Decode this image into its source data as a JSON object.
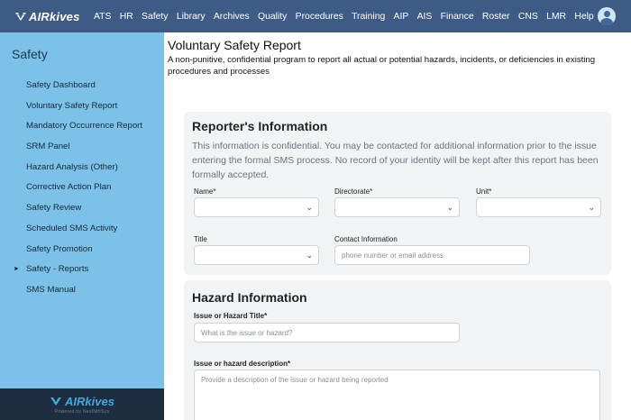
{
  "brand": {
    "name": "AIRkives"
  },
  "nav": {
    "items": [
      "ATS",
      "HR",
      "Safety",
      "Library",
      "Archives",
      "Quality",
      "Procedures",
      "Training",
      "AIP",
      "AIS",
      "Finance",
      "Roster",
      "CNS",
      "LMR",
      "Help"
    ]
  },
  "sidebar": {
    "title": "Safety",
    "items": [
      {
        "label": "Safety Dashboard"
      },
      {
        "label": "Voluntary Safety Report"
      },
      {
        "label": "Mandatory Occurrence Report"
      },
      {
        "label": "SRM Panel"
      },
      {
        "label": "Hazard Analysis (Other)"
      },
      {
        "label": "Corrective Action Plan"
      },
      {
        "label": "Safety Review"
      },
      {
        "label": "Scheduled SMS Activity"
      },
      {
        "label": "Safety Promotion"
      },
      {
        "label": "Safety - Reports",
        "arrow": "►"
      },
      {
        "label": "SMS Manual"
      }
    ],
    "footer_logo": "AIRkives",
    "footer_sub": "Powered by NextNthSys"
  },
  "main": {
    "title": "Voluntary Safety Report",
    "subtitle": "A non-punitive, confidential program to report all actual or potential hazards, incidents, or deficiencies in existing procedures and processes"
  },
  "reporter": {
    "title": "Reporter's Information",
    "description": "This information is confidential. You may be contacted for additional information prior to the issue entering the formal SMS process. No record of your identity will be kept after this report has been formally accepted.",
    "name_label": "Name*",
    "directorate_label": "Directorate*",
    "unit_label": "Unit*",
    "title_label": "Title",
    "contact_label": "Contact Information",
    "contact_placeholder": "phone number or email address"
  },
  "hazard": {
    "title": "Hazard Information",
    "issue_title_label": "Issue or Hazard Title*",
    "issue_title_placeholder": "What is the issue or hazard?",
    "description_label": "Issue or hazard description*",
    "description_placeholder": "Provide a description of the issue or hazard being reported"
  },
  "colors": {
    "nav_bg": "#3e5b85",
    "sidebar_bg": "#7cc1e7",
    "sidebar_footer_bg": "#1e2d3f",
    "card_bg": "#f1f3f5"
  }
}
